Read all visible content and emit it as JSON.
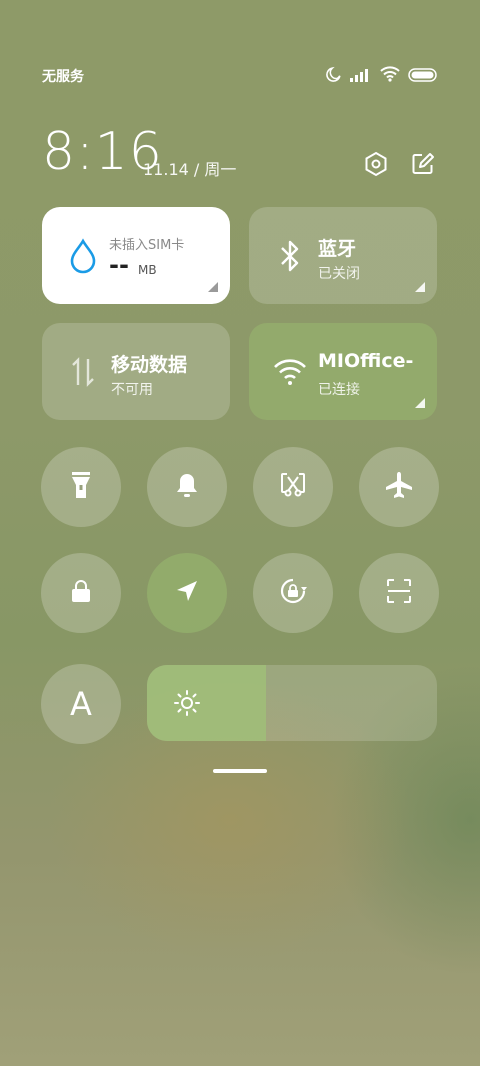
{
  "status_bar": {
    "carrier": "无服务",
    "icons": [
      "moon-icon",
      "signal-icon",
      "wifi-icon",
      "battery-icon"
    ]
  },
  "header": {
    "time": "8:16",
    "date": "11.14 / 周一",
    "settings_icon": "settings-hex-icon",
    "edit_icon": "edit-icon"
  },
  "tiles": {
    "data_usage": {
      "label": "未插入SIM卡",
      "value": "--",
      "unit": "MB",
      "icon": "water-drop-icon",
      "accent": "#1a9be6"
    },
    "bluetooth": {
      "label": "蓝牙",
      "status": "已关闭",
      "icon": "bluetooth-icon"
    },
    "mobile_data": {
      "label": "移动数据",
      "status": "不可用",
      "icon": "data-arrows-icon"
    },
    "wifi": {
      "label": "MIOffice-",
      "status": "已连接",
      "icon": "wifi-icon"
    }
  },
  "toggles_row1": [
    "flashlight-icon",
    "bell-icon",
    "screenshot-icon",
    "airplane-icon"
  ],
  "toggles_row2": [
    "lock-icon",
    "location-icon",
    "rotation-lock-icon",
    "scan-icon"
  ],
  "brightness": {
    "level": 0.41,
    "icon": "sun-icon",
    "auto_icon": "font-a-icon",
    "auto_label": "A"
  }
}
